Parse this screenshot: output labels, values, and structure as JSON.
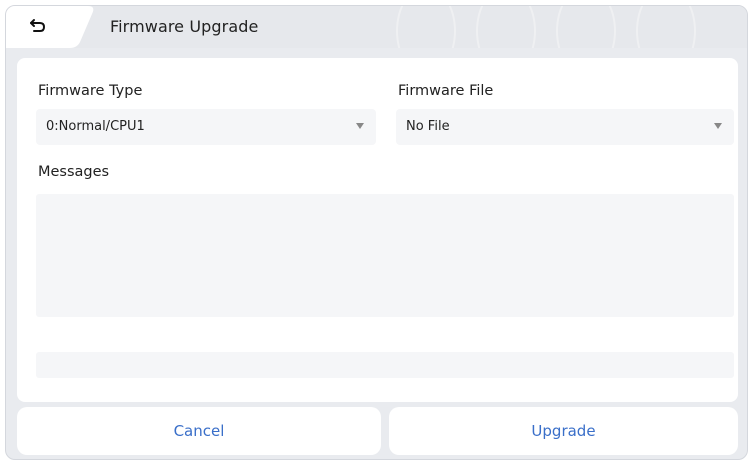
{
  "header": {
    "title": "Firmware Upgrade",
    "back_icon": "back-arrow-icon"
  },
  "form": {
    "firmware_type": {
      "label": "Firmware Type",
      "value": "0:Normal/CPU1"
    },
    "firmware_file": {
      "label": "Firmware File",
      "value": "No File"
    },
    "messages": {
      "label": "Messages",
      "content": ""
    },
    "progress": 0
  },
  "footer": {
    "cancel_label": "Cancel",
    "upgrade_label": "Upgrade"
  },
  "colors": {
    "accent": "#3a6fc9",
    "background": "#e9ebef",
    "field": "#f5f6f8"
  }
}
